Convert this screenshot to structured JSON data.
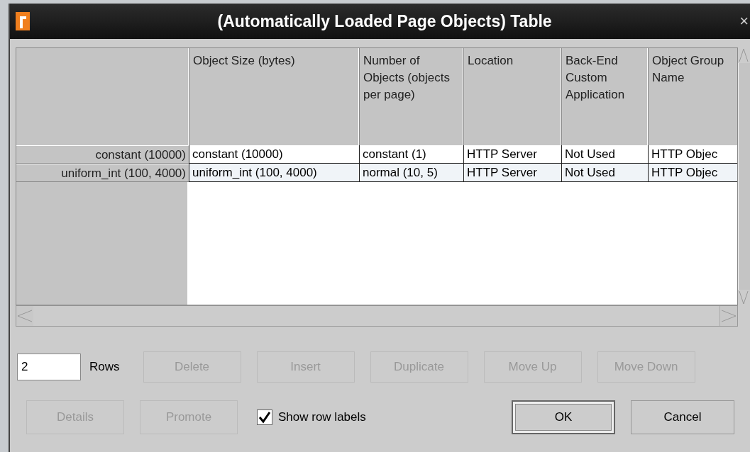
{
  "window": {
    "title": "(Automatically Loaded Page Objects) Table",
    "close": "×"
  },
  "table": {
    "columns": [
      "Object Size (bytes)",
      "Number of Objects (objects per page)",
      "Location",
      "Back-End Custom Application",
      "Object Group Name"
    ],
    "rows": [
      {
        "label": "constant (10000)",
        "selected": false,
        "cells": [
          "constant (10000)",
          "constant (1)",
          "HTTP Server",
          "Not Used",
          "HTTP Objec"
        ]
      },
      {
        "label": "uniform_int (100, 4000)",
        "selected": true,
        "cells": [
          "uniform_int (100, 4000)",
          "normal (10, 5)",
          "HTTP Server",
          "Not Used",
          "HTTP Objec"
        ]
      }
    ]
  },
  "rows_field": {
    "value": "2",
    "label": "Rows"
  },
  "buttons_row_1": [
    {
      "label": "Delete",
      "disabled": true
    },
    {
      "label": "Insert",
      "disabled": true
    },
    {
      "label": "Duplicate",
      "disabled": true
    },
    {
      "label": "Move Up",
      "disabled": true
    },
    {
      "label": "Move Down",
      "disabled": true
    }
  ],
  "buttons_row_2": [
    {
      "label": "Details",
      "disabled": true
    },
    {
      "label": "Promote",
      "disabled": true
    }
  ],
  "show_row_labels": {
    "label": "Show row labels",
    "checked": true
  },
  "dialog_buttons": [
    {
      "label": "OK",
      "disabled": false,
      "default": true
    },
    {
      "label": "Cancel",
      "disabled": false,
      "default": false
    }
  ]
}
